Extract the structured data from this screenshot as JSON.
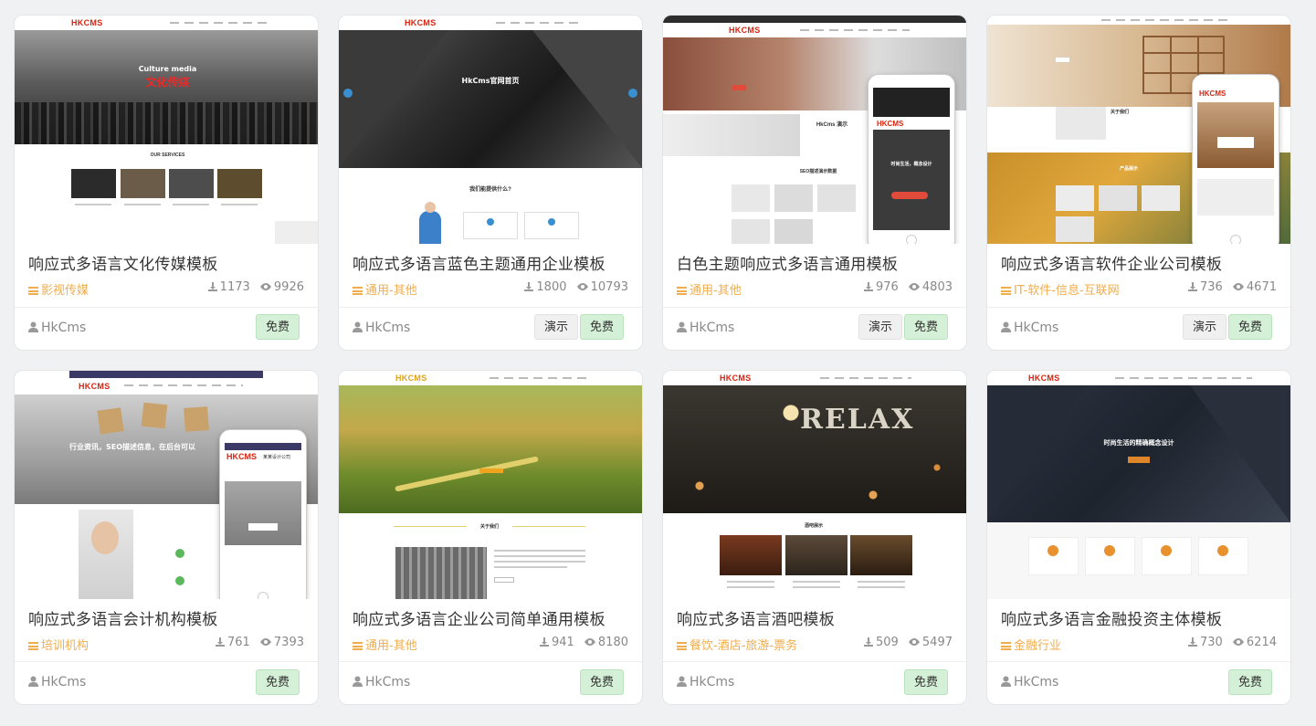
{
  "author_label": "HkCms",
  "buttons": {
    "demo": "演示",
    "free": "免费"
  },
  "cards": [
    {
      "title": "响应式多语言文化传媒模板",
      "category": "影视传媒",
      "downloads": "1173",
      "views": "9926"
    },
    {
      "title": "响应式多语言蓝色主题通用企业模板",
      "category": "通用-其他",
      "downloads": "1800",
      "views": "10793"
    },
    {
      "title": "白色主题响应式多语言通用模板",
      "category": "通用-其他",
      "downloads": "976",
      "views": "4803"
    },
    {
      "title": "响应式多语言软件企业公司模板",
      "category": "IT-软件-信息-互联网",
      "downloads": "736",
      "views": "4671"
    },
    {
      "title": "响应式多语言会计机构模板",
      "category": "培训机构",
      "downloads": "761",
      "views": "7393"
    },
    {
      "title": "响应式多语言企业公司简单通用模板",
      "category": "通用-其他",
      "downloads": "941",
      "views": "8180"
    },
    {
      "title": "响应式多语言酒吧模板",
      "category": "餐饮-酒店-旅游-票务",
      "downloads": "509",
      "views": "5497"
    },
    {
      "title": "响应式多语言金融投资主体模板",
      "category": "金融行业",
      "downloads": "730",
      "views": "6214"
    }
  ],
  "thumbs": {
    "t1": {
      "logo": "HKCMS",
      "hero_en": "Culture media",
      "hero_cn": "文化传媒",
      "section": "OUR SERVICES"
    },
    "t2": {
      "logo": "HKCMS",
      "hero": "HkCms官网首页",
      "section": "我们能提供什么?"
    },
    "t3": {
      "logo": "HKCMS",
      "section": "HkCms 演示",
      "section2": "SEO描述演示数据",
      "phone_logo": "HKCMS",
      "phone_text": "时尚生活，概念设计"
    },
    "t4": {
      "section": "关于我们",
      "section2": "产品展示",
      "phone_logo": "HKCMS"
    },
    "t5": {
      "logo": "HKCMS",
      "hero": "行业资讯，SEO描述信息，在后台可以",
      "phone_logo": "HKCMS",
      "phone_name": "某某设计公司"
    },
    "t6": {
      "logo": "HKCMS",
      "section": "关于我们"
    },
    "t7": {
      "logo": "HKCMS",
      "sign": "RELAX",
      "section": "酒吧展示"
    },
    "t8": {
      "logo": "HKCMS",
      "hero": "时尚生活的精确概念设计"
    }
  },
  "colors": {
    "accent_orange": "#f0ad4e",
    "free_bg": "#d4f0d6",
    "brand_red": "#d9230f"
  }
}
